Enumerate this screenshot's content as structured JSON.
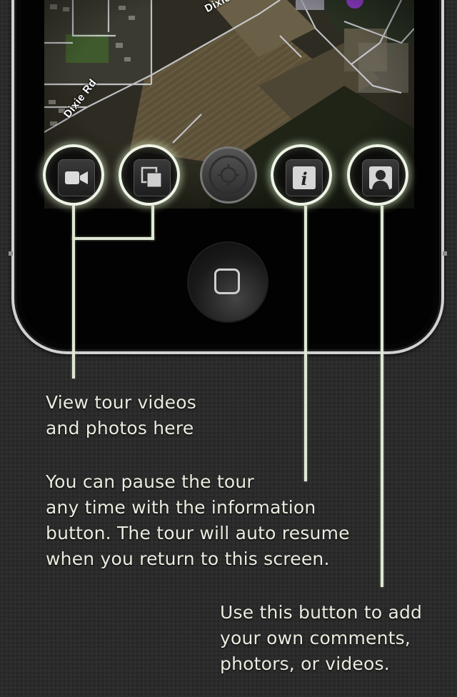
{
  "map": {
    "road_label_1": "Dixie Rd",
    "road_label_2": "Dixie"
  },
  "toolbar": {
    "buttons": [
      {
        "name": "video",
        "icon": "video-camera-icon"
      },
      {
        "name": "photos",
        "icon": "photo-stack-icon"
      },
      {
        "name": "locate",
        "icon": "crosshair-icon"
      },
      {
        "name": "info",
        "icon": "info-icon",
        "glyph": "i"
      },
      {
        "name": "profile",
        "icon": "person-icon"
      }
    ]
  },
  "callouts": {
    "media": [
      "View tour videos",
      "and photos here"
    ],
    "info": [
      "You can pause the tour",
      "any time with the information",
      "button. The tour will auto resume",
      "when you return to this screen."
    ],
    "contribute": [
      "Use this button to add",
      "your own comments,",
      "photors, or videos."
    ]
  },
  "colors": {
    "glow": "#eef4e6",
    "line": "#dfe8d6",
    "text": "#e9ecdf"
  }
}
